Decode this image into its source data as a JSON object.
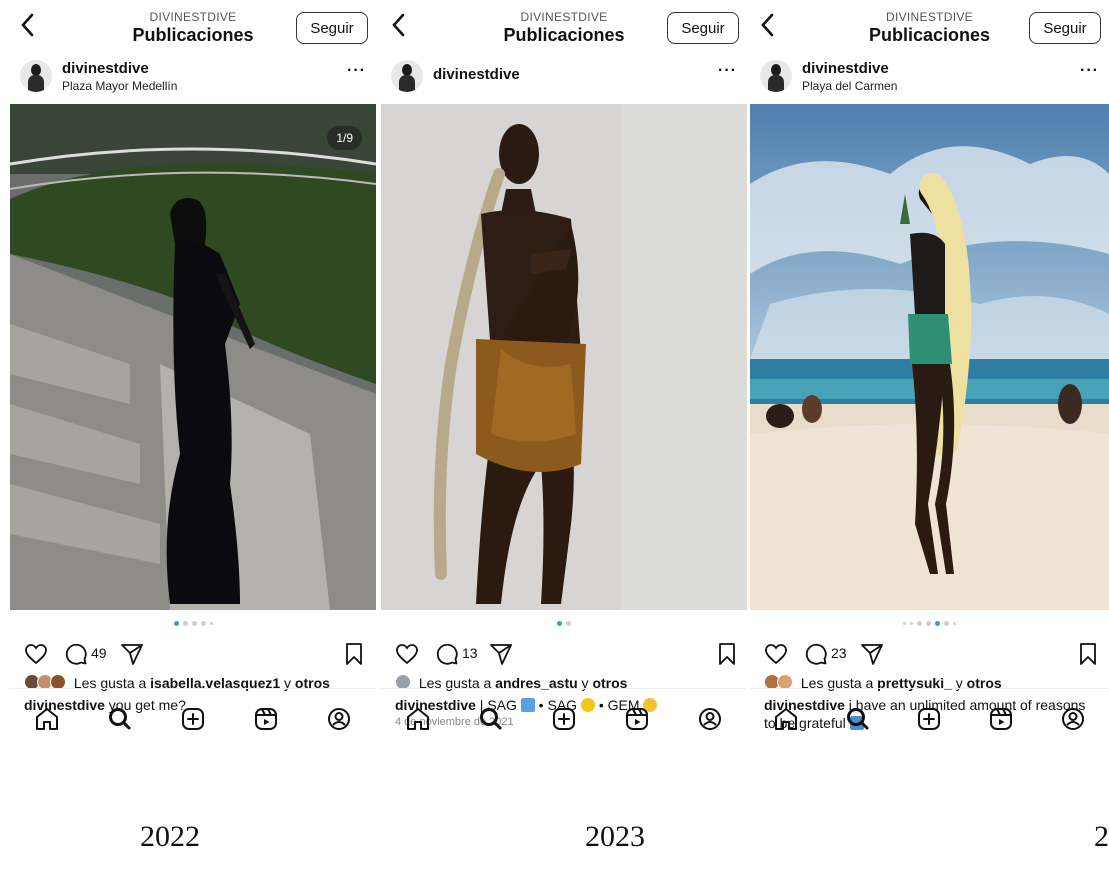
{
  "posts": [
    {
      "account": "DIVINESTDIVE",
      "title": "Publicaciones",
      "follow": "Seguir",
      "username": "divinestdive",
      "location": "Plaza Mayor Medellín",
      "more": "···",
      "counter": "1/9",
      "comments": "49",
      "liked_prefix": "Les gusta a ",
      "liked_user": "isabella.velasquez1",
      "liked_suffix": " y ",
      "liked_others": "otros",
      "caption_user": "divinestdive",
      "caption": " you get me?",
      "year": "2022"
    },
    {
      "account": "DIVINESTDIVE",
      "title": "Publicaciones",
      "follow": "Seguir",
      "username": "divinestdive",
      "location": "",
      "more": "···",
      "comments": "13",
      "liked_prefix": "Les gusta a ",
      "liked_user": "andres_astu",
      "liked_suffix": " y ",
      "liked_others": "otros",
      "caption_user": "divinestdive",
      "caption_a": " | SAG ",
      "caption_b": " • SAG ",
      "caption_c": " • GEM ",
      "date": "4 de noviembre de 2021",
      "year": "2023"
    },
    {
      "account": "DIVINESTDIVE",
      "title": "Publicaciones",
      "follow": "Seguir",
      "username": "divinestdive",
      "location": "Playa del Carmen",
      "more": "···",
      "comments": "23",
      "liked_prefix": "Les gusta a ",
      "liked_user": "prettysuki_",
      "liked_suffix": " y ",
      "liked_others": "otros",
      "caption_user": "divinestdive",
      "caption": " i have an unlimited amount of reasons to be grateful",
      "year": "2"
    }
  ],
  "icons": [
    "back-icon",
    "heart-icon",
    "comment-icon",
    "share-icon",
    "bookmark-icon",
    "home-icon",
    "search-icon",
    "create-icon",
    "reels-icon",
    "profile-icon"
  ],
  "colors": {
    "accent": "#3897f0",
    "text": "#111111",
    "muted": "#888888"
  }
}
